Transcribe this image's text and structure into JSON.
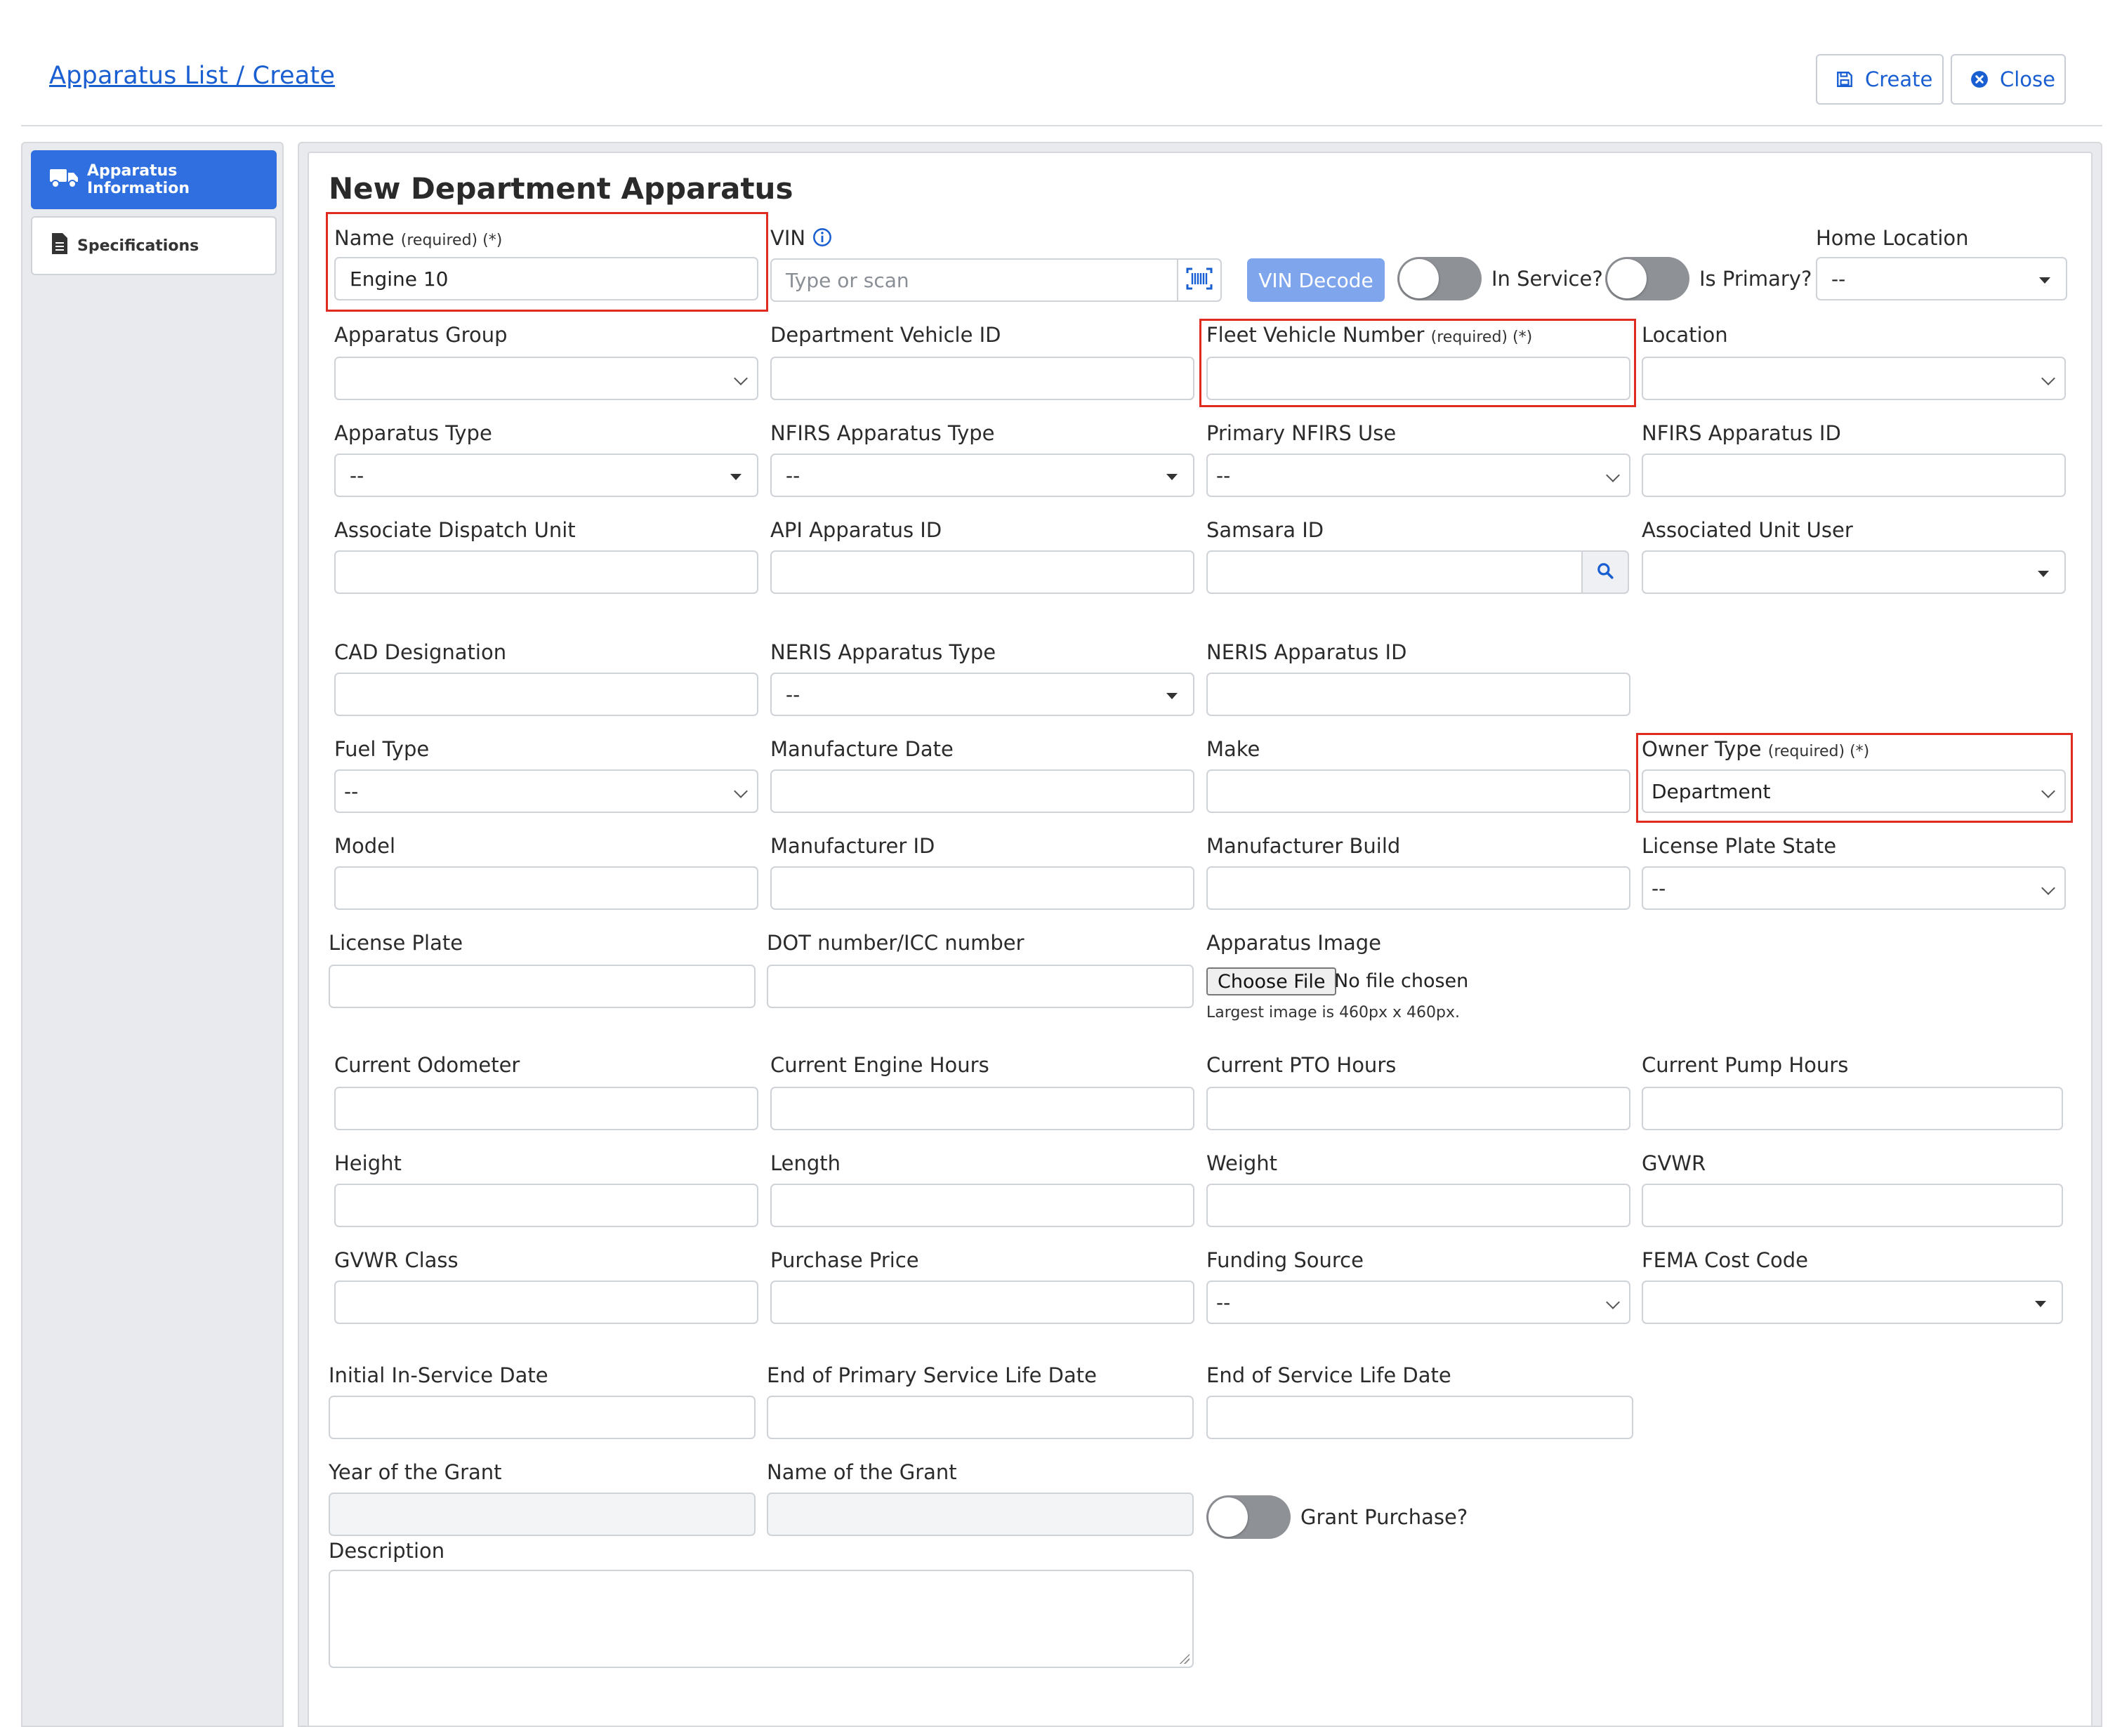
{
  "breadcrumb": "Apparatus List / Create",
  "header": {
    "create_label": "Create",
    "close_label": "Close"
  },
  "sidebar": {
    "items": [
      {
        "label": "Apparatus Information",
        "active": true
      },
      {
        "label": "Specifications",
        "active": false
      }
    ]
  },
  "form": {
    "title": "New Department Apparatus",
    "required_tag": "(required) (*)",
    "name": {
      "label": "Name",
      "value": "Engine 10"
    },
    "vin": {
      "label": "VIN",
      "placeholder": "Type or scan"
    },
    "vin_decode_label": "VIN Decode",
    "in_service_label": "In Service?",
    "is_primary_label": "Is Primary?",
    "home_location": {
      "label": "Home Location",
      "value": "--"
    },
    "apparatus_group": {
      "label": "Apparatus Group",
      "value": ""
    },
    "department_vehicle_id": {
      "label": "Department Vehicle ID",
      "value": ""
    },
    "fleet_vehicle_number": {
      "label": "Fleet Vehicle Number",
      "value": ""
    },
    "location": {
      "label": "Location",
      "value": ""
    },
    "apparatus_type": {
      "label": "Apparatus Type",
      "value": "--"
    },
    "nfirs_apparatus_type": {
      "label": "NFIRS Apparatus Type",
      "value": "--"
    },
    "primary_nfirs_use": {
      "label": "Primary NFIRS Use",
      "value": "--"
    },
    "nfirs_apparatus_id": {
      "label": "NFIRS Apparatus ID",
      "value": ""
    },
    "associate_dispatch_unit": {
      "label": "Associate Dispatch Unit",
      "value": ""
    },
    "api_apparatus_id": {
      "label": "API Apparatus ID",
      "value": ""
    },
    "samsara_id": {
      "label": "Samsara ID",
      "value": ""
    },
    "associated_unit_user": {
      "label": "Associated Unit User",
      "value": ""
    },
    "cad_designation": {
      "label": "CAD Designation",
      "value": ""
    },
    "neris_apparatus_type": {
      "label": "NERIS Apparatus Type",
      "value": "--"
    },
    "neris_apparatus_id": {
      "label": "NERIS Apparatus ID",
      "value": ""
    },
    "fuel_type": {
      "label": "Fuel Type",
      "value": "--"
    },
    "manufacture_date": {
      "label": "Manufacture Date",
      "value": ""
    },
    "make": {
      "label": "Make",
      "value": ""
    },
    "owner_type": {
      "label": "Owner Type",
      "value": "Department"
    },
    "model": {
      "label": "Model",
      "value": ""
    },
    "manufacturer_id": {
      "label": "Manufacturer ID",
      "value": ""
    },
    "manufacturer_build": {
      "label": "Manufacturer Build",
      "value": ""
    },
    "license_plate_state": {
      "label": "License Plate State",
      "value": "--"
    },
    "license_plate": {
      "label": "License Plate",
      "value": ""
    },
    "dot_number": {
      "label": "DOT number/ICC number",
      "value": ""
    },
    "apparatus_image": {
      "label": "Apparatus Image",
      "button": "Choose File",
      "file_text": "No file chosen",
      "hint": "Largest image is 460px x 460px."
    },
    "current_odometer": {
      "label": "Current Odometer",
      "value": ""
    },
    "current_engine_hours": {
      "label": "Current Engine Hours",
      "value": ""
    },
    "current_pto_hours": {
      "label": "Current PTO Hours",
      "value": ""
    },
    "current_pump_hours": {
      "label": "Current Pump Hours",
      "value": ""
    },
    "height": {
      "label": "Height",
      "value": ""
    },
    "length": {
      "label": "Length",
      "value": ""
    },
    "weight": {
      "label": "Weight",
      "value": ""
    },
    "gvwr": {
      "label": "GVWR",
      "value": ""
    },
    "gvwr_class": {
      "label": "GVWR Class",
      "value": ""
    },
    "purchase_price": {
      "label": "Purchase Price",
      "value": ""
    },
    "funding_source": {
      "label": "Funding Source",
      "value": "--"
    },
    "fema_cost_code": {
      "label": "FEMA Cost Code",
      "value": ""
    },
    "initial_in_service_date": {
      "label": "Initial In-Service Date",
      "value": ""
    },
    "end_primary_service_life_date": {
      "label": "End of Primary Service Life Date",
      "value": ""
    },
    "end_service_life_date": {
      "label": "End of Service Life Date",
      "value": ""
    },
    "year_of_grant": {
      "label": "Year of the Grant",
      "value": ""
    },
    "name_of_grant": {
      "label": "Name of the Grant",
      "value": ""
    },
    "grant_purchase_label": "Grant Purchase?",
    "description": {
      "label": "Description",
      "value": ""
    }
  },
  "colors": {
    "accent": "#2f6fe0",
    "link": "#1a5fd1",
    "required_outline": "#e02b20",
    "toggle_off": "#8e9196"
  }
}
